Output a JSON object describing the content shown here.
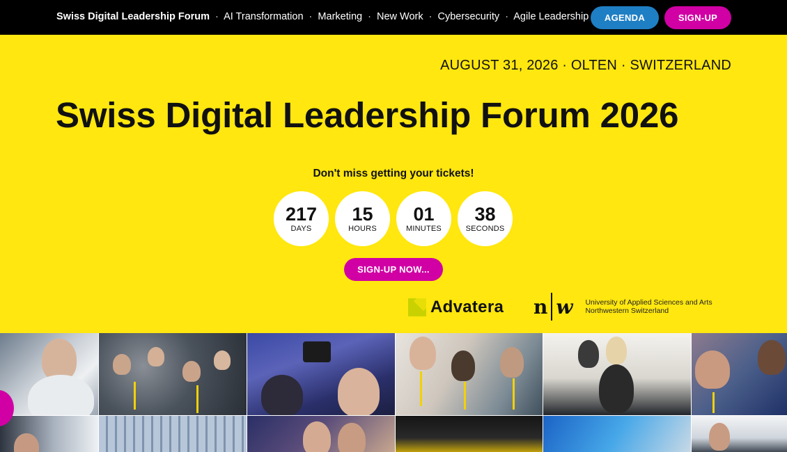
{
  "nav": {
    "brand": "Swiss Digital Leadership Forum",
    "items": [
      "AI Transformation",
      "Marketing",
      "New Work",
      "Cybersecurity",
      "Agile Leadership"
    ],
    "separator": "·",
    "agenda_label": "AGENDA",
    "signup_label": "SIGN-UP"
  },
  "hero": {
    "date_location": "AUGUST 31, 2026 · OLTEN · SWITZERLAND",
    "title": "Swiss Digital Leadership Forum 2026",
    "tagline": "Don't miss getting your tickets!",
    "cta_label": "SIGN-UP NOW..."
  },
  "countdown": [
    {
      "value": "217",
      "unit": "DAYS"
    },
    {
      "value": "15",
      "unit": "HOURS"
    },
    {
      "value": "01",
      "unit": "MINUTES"
    },
    {
      "value": "38",
      "unit": "SECONDS"
    }
  ],
  "sponsors": {
    "advatera": "Advatera",
    "fhnw_logo_left": "n",
    "fhnw_logo_right": "w",
    "fhnw_line1": "University of Applied Sciences and Arts",
    "fhnw_line2": "Northwestern Switzerland"
  },
  "colors": {
    "background": "#ffe70f",
    "topbar": "#000000",
    "accent_blue": "#1f7fc4",
    "accent_magenta": "#d000a4"
  }
}
